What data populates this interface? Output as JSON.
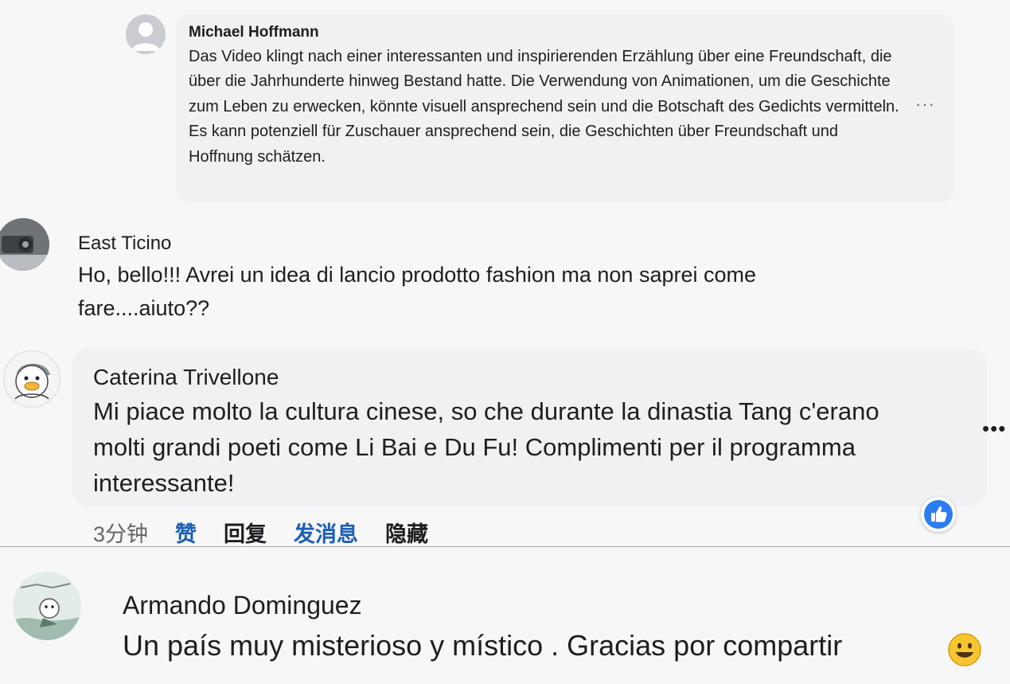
{
  "comments": [
    {
      "author": "Michael Hoffmann",
      "text": "Das Video klingt nach einer interessanten und inspirierenden Erzählung über eine Freundschaft, die über die Jahrhunderte hinweg Bestand hatte. Die Verwendung von Animationen, um die Geschichte zum Leben zu erwecken, könnte visuell ansprechend sein und die Botschaft des Gedichts vermitteln. Es kann potenziell für Zuschauer ansprechend sein, die Geschichten über Freundschaft und Hoffnung schätzen.",
      "more": "···",
      "avatar_icon": "default-user-avatar"
    },
    {
      "author": "East Ticino",
      "text": "Ho, bello!!! Avrei un idea di lancio prodotto fashion ma non saprei come fare....aiuto??",
      "avatar_icon": "photo-avatar"
    },
    {
      "author": "Caterina Trivellone",
      "text": "Mi piace molto la cultura cinese, so che durante la dinastia Tang c'erano molti grandi poeti come Li Bai e Du Fu! Complimenti per il programma interessante!",
      "more": "•••",
      "avatar_icon": "cartoon-duck-avatar",
      "reaction_icon": "like-thumb-icon",
      "actions": {
        "time": "3分钟",
        "like": "赞",
        "reply": "回复",
        "message": "发消息",
        "hide": "隐藏"
      }
    },
    {
      "author": "Armando Dominguez",
      "text": "Un país muy misterioso y místico . Gracias por compartir",
      "emoji_icon": "smiley-emoji-icon",
      "avatar_icon": "illustration-avatar"
    }
  ],
  "colors": {
    "page_bg": "#f7f7f7",
    "bubble_bg": "#f0f1f3",
    "text": "#1c1e21",
    "secondary_text": "#65676b",
    "link_blue": "#1b5fb8",
    "like_blue": "#2d7cf0"
  }
}
